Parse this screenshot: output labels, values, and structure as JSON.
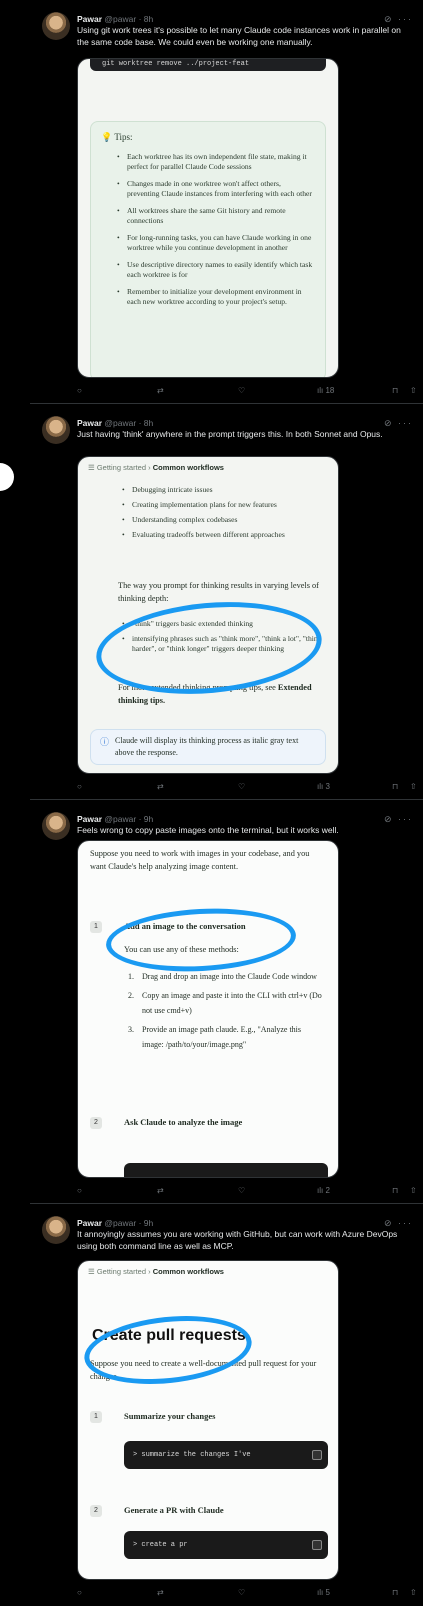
{
  "posts": [
    {
      "name": "Pawar",
      "handle": "@pawar",
      "time": "8h",
      "text": "Using git work trees it's possible to let many Claude code instances work in parallel on the same code base.  We could even be working one manually.",
      "media": {
        "code": "git worktree remove ../project-feat",
        "tips_title": "Tips:",
        "tips": [
          "Each worktree has its own independent file state, making it perfect for parallel Claude Code sessions",
          "Changes made in one worktree won't affect others, preventing Claude instances from interfering with each other",
          "All worktrees share the same Git history and remote connections",
          "For long-running tasks, you can have Claude working in one worktree while you continue development in another",
          "Use descriptive directory names to easily identify which task each worktree is for",
          "Remember to initialize your development environment in each new worktree according to your project's setup."
        ]
      },
      "views": "18"
    },
    {
      "name": "Pawar",
      "handle": "@pawar",
      "time": "8h",
      "text": "Just having 'think' anywhere in the prompt triggers this. In both Sonnet and Opus.",
      "media": {
        "crumb_parent": "Getting started",
        "crumb_current": "Common workflows",
        "bullets": [
          "Debugging intricate issues",
          "Creating implementation plans for new features",
          "Understanding complex codebases",
          "Evaluating tradeoffs between different approaches"
        ],
        "para": "The way you prompt for thinking results in varying levels of thinking depth:",
        "bullets2": [
          "\"think\" triggers basic extended thinking",
          "intensifying phrases such as \"think more\", \"think a lot\", \"think harder\", or \"think longer\" triggers deeper thinking"
        ],
        "para2_a": "For more extended thinking prompting tips, see ",
        "para2_b": "Extended thinking tips.",
        "info": "Claude will display its thinking process as italic gray text above the response."
      },
      "views": "3"
    },
    {
      "name": "Pawar",
      "handle": "@pawar",
      "time": "9h",
      "text": "Feels wrong to copy paste images onto the terminal, but it works well.",
      "media": {
        "intro": "Suppose you need to work with images in your codebase, and you want Claude's help analyzing image content.",
        "step1_num": "1",
        "step1_title": "Add an image to the conversation",
        "step1_sub": "You can use any of these methods:",
        "methods": [
          {
            "n": "1.",
            "t": "Drag and drop an image into the Claude Code window"
          },
          {
            "n": "2.",
            "t": "Copy an image and paste it into the CLI with ctrl+v (Do not use cmd+v)"
          },
          {
            "n": "3.",
            "t": "Provide an image path claude. E.g., \"Analyze this image: /path/to/your/image.png\""
          }
        ],
        "step2_num": "2",
        "step2_title": "Ask Claude to analyze the image"
      },
      "views": "2"
    },
    {
      "name": "Pawar",
      "handle": "@pawar",
      "time": "9h",
      "text": "It annoyingly assumes you are working with GitHub, but can work with Azure DevOps using both command line as well as MCP.",
      "media": {
        "crumb_parent": "Getting started",
        "crumb_current": "Common workflows",
        "title": "Create pull requests",
        "intro": "Suppose you need to create a well-documented pull request for your changes.",
        "step1_num": "1",
        "step1_title": "Summarize your changes",
        "code1": "> summarize the changes I've",
        "step2_num": "2",
        "step2_title": "Generate a PR with Claude",
        "code2": "> create a pr"
      },
      "views": "5"
    }
  ],
  "icons": {
    "reply": "reply-icon",
    "repost": "repost-icon",
    "like": "like-icon",
    "views": "views-icon",
    "bookmark": "bookmark-icon",
    "share": "share-icon",
    "grok": "grok-icon",
    "more": "more-icon",
    "tip": "lightbulb-icon",
    "info": "info-icon"
  },
  "colors": {
    "background": "#000000",
    "annotation": "#1a9af2",
    "tip_icon": "#2f9e6a"
  }
}
